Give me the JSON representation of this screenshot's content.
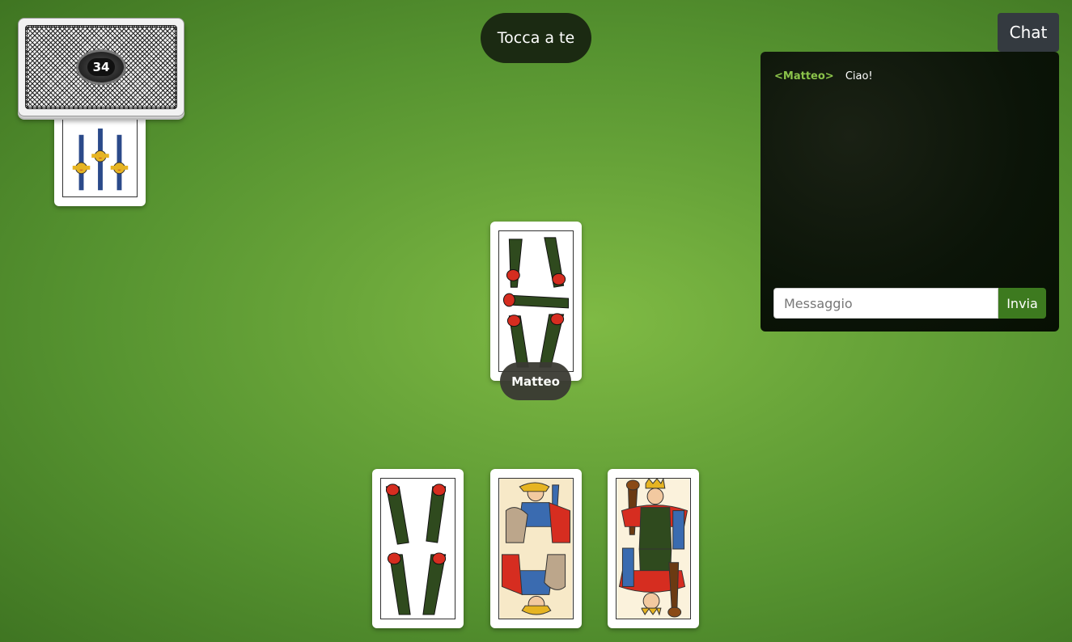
{
  "turn": {
    "label": "Tocca a te"
  },
  "deck": {
    "remaining": "34",
    "icon": "card-back-icon"
  },
  "briscola": {
    "suit": "spade",
    "value": 3,
    "icon": "three-of-swords-icon"
  },
  "table": {
    "played_card": {
      "suit": "bastoni",
      "value": 5,
      "icon": "five-of-clubs-icon"
    },
    "player_name": "Matteo"
  },
  "hand": [
    {
      "suit": "bastoni",
      "value": 4,
      "icon": "four-of-clubs-icon"
    },
    {
      "suit": "spade",
      "figure": "cavallo",
      "icon": "knight-of-swords-icon"
    },
    {
      "suit": "bastoni",
      "figure": "re",
      "icon": "king-of-clubs-icon"
    }
  ],
  "chat": {
    "toggle_label": "Chat",
    "messages": [
      {
        "author": "<Matteo>",
        "text": "Ciao!"
      }
    ],
    "input_placeholder": "Messaggio",
    "send_label": "Invia"
  },
  "colors": {
    "table_green": "#6aa63a",
    "chat_bg": "#0b1408",
    "author_green": "#8bc34a",
    "send_button": "#3d7a1f"
  }
}
